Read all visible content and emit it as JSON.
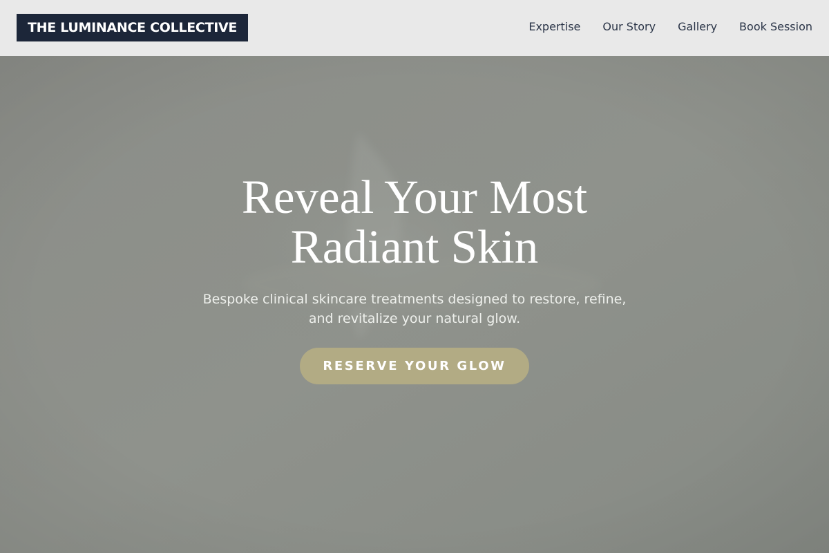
{
  "header": {
    "brand": "THE LUMINANCE COLLECTIVE",
    "nav": [
      {
        "label": "Expertise"
      },
      {
        "label": "Our Story"
      },
      {
        "label": "Gallery"
      },
      {
        "label": "Book Session"
      }
    ]
  },
  "hero": {
    "title_line1": "Reveal Your Most",
    "title_line2": "Radiant Skin",
    "subtitle_line1": "Bespoke clinical skincare treatments designed to restore, refine,",
    "subtitle_line2": "and revitalize your natural glow.",
    "cta_label": "RESERVE YOUR GLOW"
  },
  "colors": {
    "header_bg": "#e9e9e9",
    "brand_bg": "#1c2639",
    "nav_text": "#2a3447",
    "hero_overlay": "#8a8d87",
    "cta_bg": "#b2ab84"
  }
}
